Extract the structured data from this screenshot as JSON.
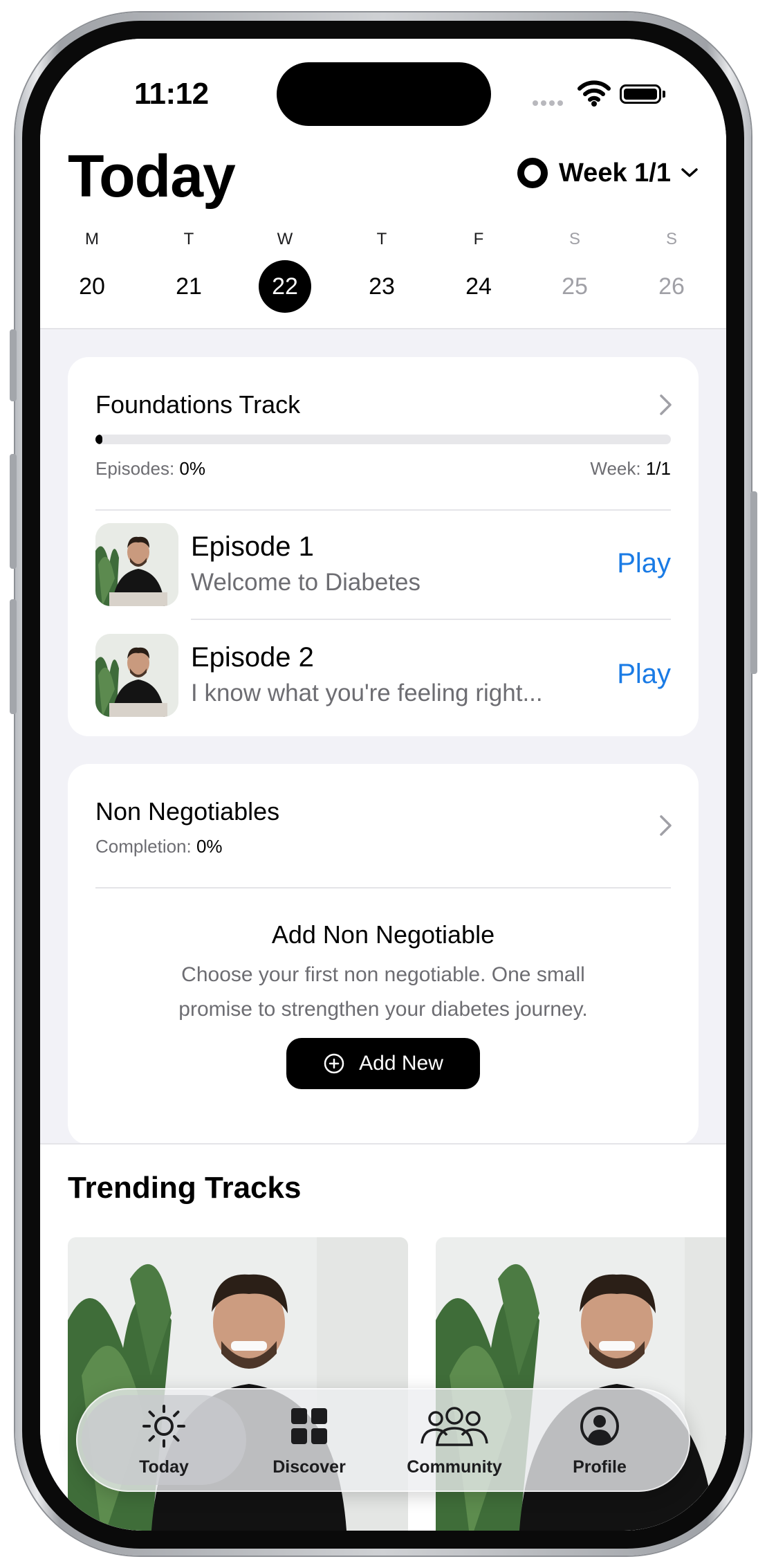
{
  "status_bar": {
    "time": "11:12"
  },
  "header": {
    "title": "Today",
    "week_selector": "Week 1/1"
  },
  "week_days": [
    {
      "letter": "M",
      "date": "20",
      "state": "normal"
    },
    {
      "letter": "T",
      "date": "21",
      "state": "normal"
    },
    {
      "letter": "W",
      "date": "22",
      "state": "selected"
    },
    {
      "letter": "T",
      "date": "23",
      "state": "normal"
    },
    {
      "letter": "F",
      "date": "24",
      "state": "normal"
    },
    {
      "letter": "S",
      "date": "25",
      "state": "muted"
    },
    {
      "letter": "S",
      "date": "26",
      "state": "muted"
    }
  ],
  "foundations": {
    "title": "Foundations Track",
    "episodes_label": "Episodes:",
    "episodes_value": "0%",
    "week_label": "Week:",
    "week_value": "1/1",
    "progress_fraction": 0.01,
    "episodes": [
      {
        "title": "Episode 1",
        "subtitle": "Welcome to Diabetes",
        "action": "Play"
      },
      {
        "title": "Episode 2",
        "subtitle": "I know what you're feeling right...",
        "action": "Play"
      }
    ]
  },
  "non_negotiables": {
    "title": "Non Negotiables",
    "completion_label": "Completion:",
    "completion_value": "0%",
    "empty_title": "Add Non Negotiable",
    "empty_line1": "Choose your first non negotiable. One small",
    "empty_line2": "promise to strengthen your diabetes journey.",
    "add_button": "Add New"
  },
  "trending": {
    "title": "Trending Tracks"
  },
  "tabbar": {
    "tabs": [
      {
        "label": "Today",
        "icon": "sun-icon",
        "active": true
      },
      {
        "label": "Discover",
        "icon": "grid-icon",
        "active": false
      },
      {
        "label": "Community",
        "icon": "people-icon",
        "active": false
      },
      {
        "label": "Profile",
        "icon": "person-circle-icon",
        "active": false
      }
    ]
  },
  "colors": {
    "accent_blue": "#1a7be5",
    "background": "#f2f2f7",
    "primary": "#000000"
  }
}
